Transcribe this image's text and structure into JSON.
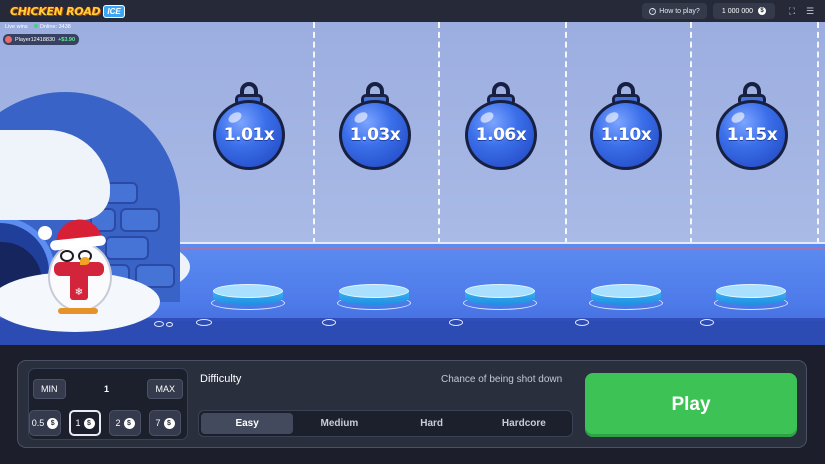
{
  "header": {
    "logo_text": "CHICKEN ROAD",
    "logo_badge": "ICE",
    "how_to_play": "How to play?",
    "balance": "1 000 000",
    "currency_symbol": "$"
  },
  "live": {
    "live_wins_label": "Live wins",
    "online_label": "Online: 3438",
    "player_name": "Player12418830",
    "player_win": "+$3.90"
  },
  "lanes": [
    {
      "multiplier": "1.01x"
    },
    {
      "multiplier": "1.03x"
    },
    {
      "multiplier": "1.06x"
    },
    {
      "multiplier": "1.10x"
    },
    {
      "multiplier": "1.15x"
    }
  ],
  "bet": {
    "min_label": "MIN",
    "max_label": "MAX",
    "value": "1",
    "chips": [
      "0.5",
      "1",
      "2",
      "7"
    ],
    "selected_chip": "1"
  },
  "difficulty": {
    "title": "Difficulty",
    "chance_label": "Chance of being shot down",
    "options": [
      "Easy",
      "Medium",
      "Hard",
      "Hardcore"
    ],
    "selected": "Easy"
  },
  "play_label": "Play",
  "colors": {
    "play_green": "#3cc255",
    "panel_bg": "#2a2f3d",
    "lantern_blue": "#3b6fea"
  }
}
